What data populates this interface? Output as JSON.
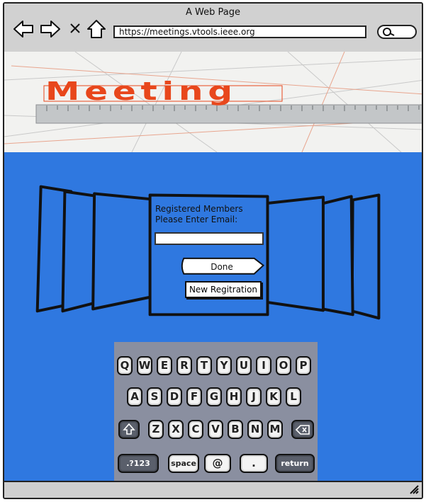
{
  "browser": {
    "title": "A Web Page",
    "url": "https://meetings.vtools.ieee.org",
    "nav_icons": [
      "back-arrow-icon",
      "forward-arrow-icon",
      "close-icon",
      "home-icon"
    ],
    "search_icon": "search-icon"
  },
  "hero": {
    "logo_text": "Meeting",
    "accent": "#e8471c"
  },
  "login": {
    "prompt_line1": "Registered Members",
    "prompt_line2": "Please Enter Email:",
    "email_value": "",
    "done_label": "Done",
    "new_registration_label": "New Regitration"
  },
  "keyboard": {
    "row1": [
      "Q",
      "W",
      "E",
      "R",
      "T",
      "Y",
      "U",
      "I",
      "O",
      "P"
    ],
    "row2": [
      "A",
      "S",
      "D",
      "F",
      "G",
      "H",
      "J",
      "K",
      "L"
    ],
    "row3": [
      "Z",
      "X",
      "C",
      "V",
      "B",
      "N",
      "M"
    ],
    "shift_icon": "shift-up-arrow-icon",
    "backspace_icon": "backspace-icon",
    "numbers_label": ".?123",
    "space_label": "space",
    "at_label": "@",
    "dot_label": ".",
    "return_label": "return"
  },
  "colors": {
    "background": "#2f78e0",
    "chrome": "#d1d1d1",
    "keyboard": "#8a8fa0"
  }
}
